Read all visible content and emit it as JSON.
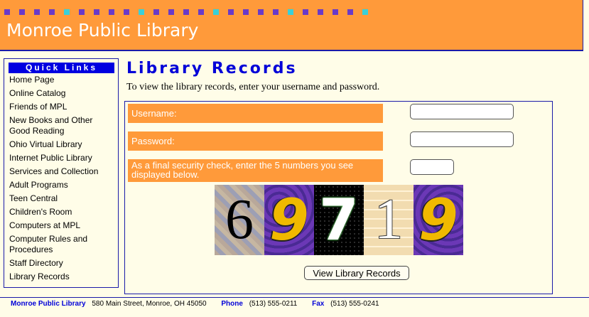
{
  "header": {
    "site_title": "Monroe Public Library",
    "dot_colors": [
      "#6a3ac8",
      "#6a3ac8",
      "#6a3ac8",
      "#6a3ac8",
      "#3ad0d8",
      "#6a3ac8",
      "#6a3ac8",
      "#6a3ac8",
      "#6a3ac8",
      "#3ad0d8",
      "#6a3ac8",
      "#6a3ac8",
      "#6a3ac8",
      "#6a3ac8",
      "#3ad0d8",
      "#6a3ac8",
      "#6a3ac8",
      "#6a3ac8",
      "#6a3ac8",
      "#3ad0d8",
      "#6a3ac8",
      "#6a3ac8",
      "#6a3ac8",
      "#6a3ac8",
      "#3ad0d8"
    ],
    "bg_color": "#ff9a3a"
  },
  "sidebar": {
    "title": "Quick Links",
    "items": [
      {
        "label": "Home Page"
      },
      {
        "label": "Online Catalog"
      },
      {
        "label": "Friends of MPL"
      },
      {
        "label": "New Books and Other Good Reading"
      },
      {
        "label": "Ohio Virtual Library"
      },
      {
        "label": "Internet Public Library"
      },
      {
        "label": "Services and Collection"
      },
      {
        "label": "Adult Programs"
      },
      {
        "label": "Teen Central"
      },
      {
        "label": "Children's Room"
      },
      {
        "label": "Computers at MPL"
      },
      {
        "label": "Computer Rules and Procedures"
      },
      {
        "label": "Staff Directory"
      },
      {
        "label": "Library Records"
      }
    ]
  },
  "main": {
    "title": "Library Records",
    "intro": "To view the library records, enter your username and password.",
    "username_label": "Username:",
    "username_value": "",
    "password_label": "Password:",
    "password_value": "",
    "security_label": "As a final security check, enter the 5 numbers you see displayed below.",
    "security_value": "",
    "captcha_digits": [
      "6",
      "9",
      "7",
      "1",
      "9"
    ],
    "submit_label": "View Library Records"
  },
  "footer": {
    "name": "Monroe Public Library",
    "address": "580 Main Street, Monroe, OH   45050",
    "phone_label": "Phone",
    "phone": "(513) 555-0211",
    "fax_label": "Fax",
    "fax": "(513) 555-0241"
  },
  "colors": {
    "accent_orange": "#ff9a3a",
    "link_blue": "#0000d8",
    "border_blue": "#1a1aa8",
    "page_bg": "#fffde8"
  }
}
